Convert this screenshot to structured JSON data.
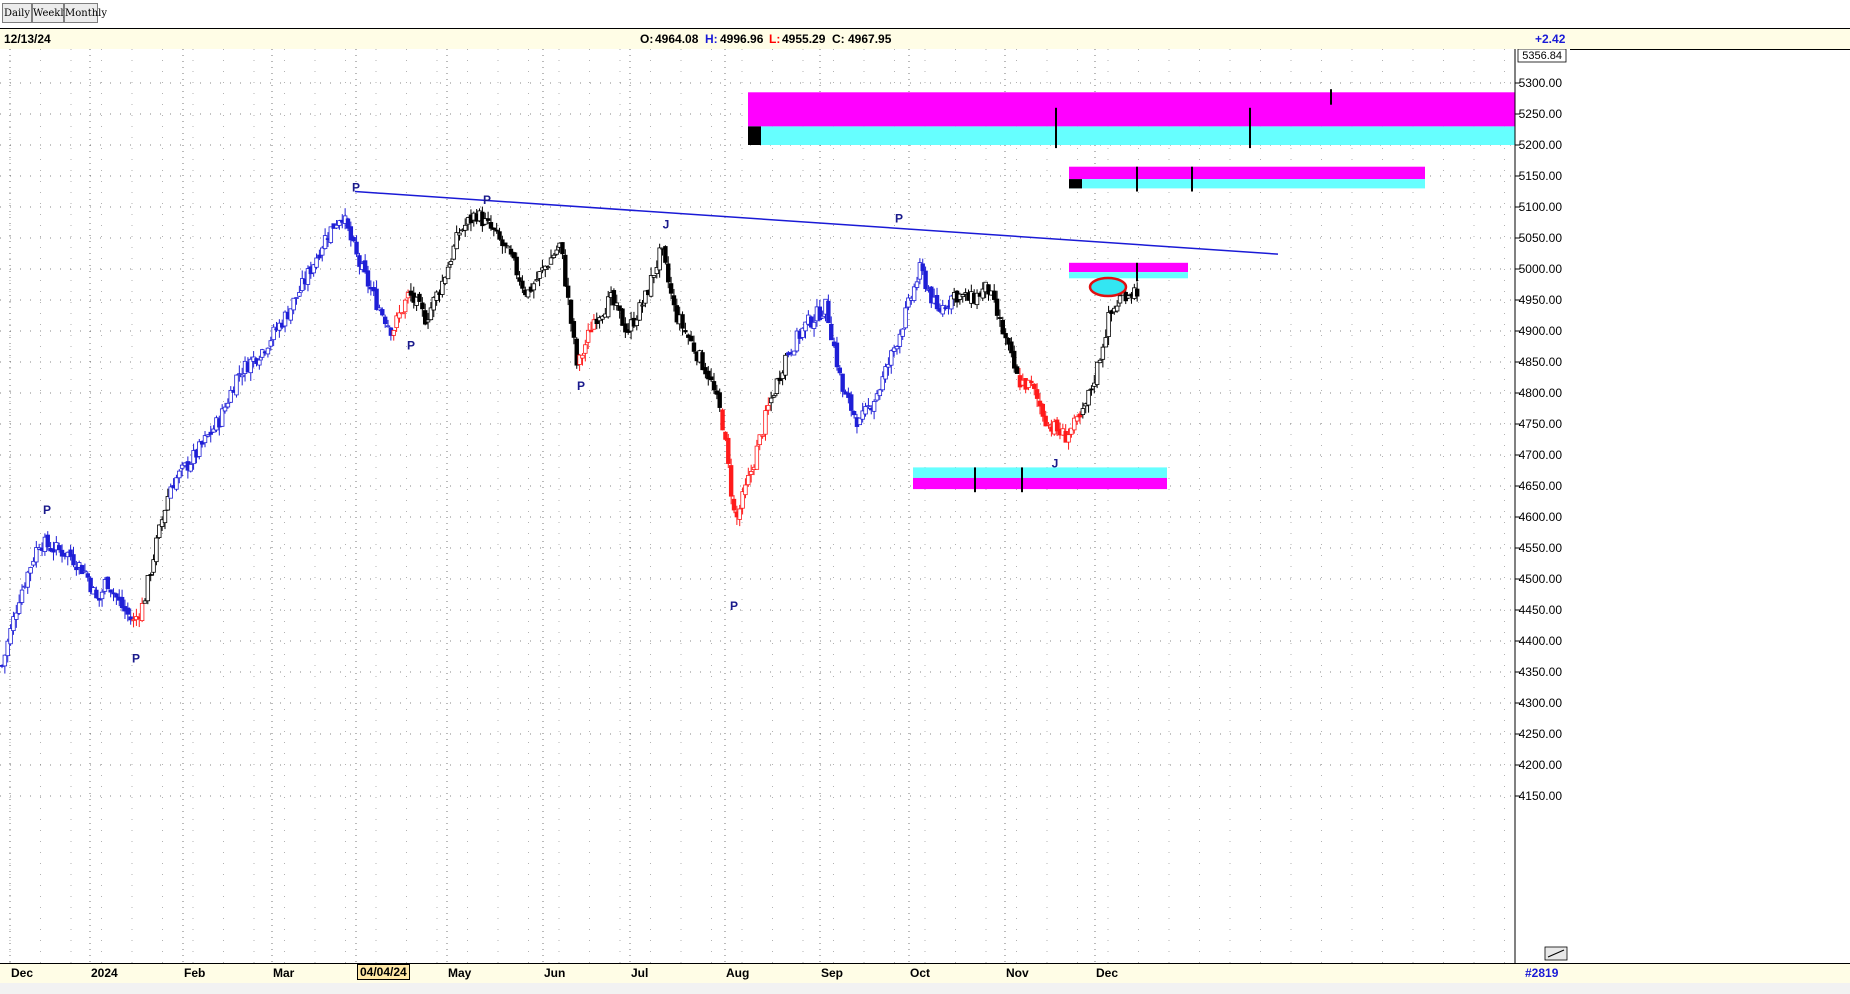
{
  "toolbar": {
    "daily": "Daily",
    "weekly": "Weekly",
    "monthly": "Monthly"
  },
  "info": {
    "date": "12/13/24",
    "open_label": "O:",
    "open": "4964.08",
    "high_label": "H:",
    "high": "4996.96",
    "low_label": "L:",
    "low": "4955.29",
    "close_label": "C:",
    "close": "4967.95",
    "change": "+2.42"
  },
  "right_axis": {
    "top_value": "5356.84",
    "count": "#2819"
  },
  "colors": {
    "up": "#1f1fd6",
    "down": "#ff1a1a",
    "neutral": "#000000",
    "magenta": "#ff00ff",
    "cyan": "#66ffff",
    "trend": "#1a1ad6"
  },
  "chart_data": {
    "type": "candlestick",
    "y_range": [
      4120,
      5370
    ],
    "y_ticks": [
      4150,
      4200,
      4250,
      4300,
      4350,
      4400,
      4450,
      4500,
      4550,
      4600,
      4650,
      4700,
      4750,
      4800,
      4850,
      4900,
      4950,
      5000,
      5050,
      5100,
      5150,
      5200,
      5250,
      5300
    ],
    "x_labels": [
      "Dec",
      "2024",
      "Feb",
      "Mar",
      "04/04/24",
      "May",
      "Jun",
      "Jul",
      "Aug",
      "Sep",
      "Oct",
      "Nov",
      "Dec"
    ],
    "selected_label": "04/04/24",
    "control_points": [
      {
        "d": 0,
        "c": 4360,
        "col": "u"
      },
      {
        "d": 10,
        "c": 4470,
        "col": "u"
      },
      {
        "d": 22,
        "c": 4560,
        "col": "u"
      },
      {
        "d": 30,
        "c": 4550,
        "col": "u"
      },
      {
        "d": 40,
        "c": 4540,
        "col": "u"
      },
      {
        "d": 50,
        "c": 4510,
        "col": "u"
      },
      {
        "d": 57,
        "c": 4460,
        "col": "u"
      },
      {
        "d": 62,
        "c": 4500,
        "col": "u"
      },
      {
        "d": 70,
        "c": 4460,
        "col": "u"
      },
      {
        "d": 78,
        "c": 4430,
        "col": "d"
      },
      {
        "d": 84,
        "c": 4460,
        "col": "n"
      },
      {
        "d": 92,
        "c": 4560,
        "col": "n"
      },
      {
        "d": 100,
        "c": 4650,
        "col": "u"
      },
      {
        "d": 115,
        "c": 4700,
        "col": "u"
      },
      {
        "d": 130,
        "c": 4760,
        "col": "u"
      },
      {
        "d": 140,
        "c": 4830,
        "col": "u"
      },
      {
        "d": 155,
        "c": 4870,
        "col": "u"
      },
      {
        "d": 170,
        "c": 4930,
        "col": "u"
      },
      {
        "d": 180,
        "c": 4980,
        "col": "u"
      },
      {
        "d": 192,
        "c": 5050,
        "col": "u"
      },
      {
        "d": 202,
        "c": 5090,
        "col": "u"
      },
      {
        "d": 212,
        "c": 5010,
        "col": "u"
      },
      {
        "d": 222,
        "c": 4950,
        "col": "u"
      },
      {
        "d": 232,
        "c": 4900,
        "col": "d"
      },
      {
        "d": 242,
        "c": 4960,
        "col": "n"
      },
      {
        "d": 252,
        "c": 4920,
        "col": "n"
      },
      {
        "d": 262,
        "c": 4980,
        "col": "n"
      },
      {
        "d": 272,
        "c": 5060,
        "col": "n"
      },
      {
        "d": 282,
        "c": 5090,
        "col": "n"
      },
      {
        "d": 292,
        "c": 5060,
        "col": "n"
      },
      {
        "d": 302,
        "c": 5020,
        "col": "n"
      },
      {
        "d": 312,
        "c": 4960,
        "col": "n"
      },
      {
        "d": 322,
        "c": 5000,
        "col": "n"
      },
      {
        "d": 332,
        "c": 5040,
        "col": "n"
      },
      {
        "d": 342,
        "c": 4840,
        "col": "d"
      },
      {
        "d": 352,
        "c": 4920,
        "col": "n"
      },
      {
        "d": 362,
        "c": 4950,
        "col": "n"
      },
      {
        "d": 372,
        "c": 4900,
        "col": "n"
      },
      {
        "d": 382,
        "c": 4950,
        "col": "n"
      },
      {
        "d": 392,
        "c": 5030,
        "col": "n"
      },
      {
        "d": 400,
        "c": 4930,
        "col": "n"
      },
      {
        "d": 410,
        "c": 4880,
        "col": "n"
      },
      {
        "d": 420,
        "c": 4830,
        "col": "n"
      },
      {
        "d": 428,
        "c": 4760,
        "col": "d"
      },
      {
        "d": 436,
        "c": 4590,
        "col": "d"
      },
      {
        "d": 446,
        "c": 4680,
        "col": "d"
      },
      {
        "d": 456,
        "c": 4780,
        "col": "n"
      },
      {
        "d": 466,
        "c": 4860,
        "col": "u"
      },
      {
        "d": 478,
        "c": 4910,
        "col": "u"
      },
      {
        "d": 490,
        "c": 4940,
        "col": "u"
      },
      {
        "d": 500,
        "c": 4800,
        "col": "u"
      },
      {
        "d": 510,
        "c": 4750,
        "col": "u"
      },
      {
        "d": 522,
        "c": 4810,
        "col": "u"
      },
      {
        "d": 534,
        "c": 4900,
        "col": "u"
      },
      {
        "d": 546,
        "c": 5000,
        "col": "u"
      },
      {
        "d": 556,
        "c": 4930,
        "col": "u"
      },
      {
        "d": 566,
        "c": 4960,
        "col": "n"
      },
      {
        "d": 576,
        "c": 4950,
        "col": "n"
      },
      {
        "d": 586,
        "c": 4970,
        "col": "n"
      },
      {
        "d": 596,
        "c": 4890,
        "col": "n"
      },
      {
        "d": 604,
        "c": 4820,
        "col": "d"
      },
      {
        "d": 612,
        "c": 4810,
        "col": "d"
      },
      {
        "d": 622,
        "c": 4750,
        "col": "d"
      },
      {
        "d": 632,
        "c": 4730,
        "col": "d"
      },
      {
        "d": 642,
        "c": 4760,
        "col": "n"
      },
      {
        "d": 650,
        "c": 4830,
        "col": "n"
      },
      {
        "d": 658,
        "c": 4920,
        "col": "n"
      },
      {
        "d": 666,
        "c": 4960,
        "col": "n"
      },
      {
        "d": 676,
        "c": 4968,
        "col": "n"
      }
    ],
    "trend_line": {
      "from": [
        355,
        5125
      ],
      "to": [
        1278,
        5024
      ]
    },
    "zones": [
      {
        "x1": 748,
        "x2": 1515,
        "top": 5285,
        "mid": 5230,
        "bottom": 5200
      },
      {
        "x1": 1069,
        "x2": 1425,
        "top": 5165,
        "mid": 5145,
        "bottom": 5130
      },
      {
        "x1": 1069,
        "x2": 1188,
        "top": 5010,
        "mid": 4995,
        "bottom": 4985
      },
      {
        "x1": 913,
        "x2": 1167,
        "top": 4680,
        "mid": 4663,
        "bottom": 4645,
        "inverted": true
      }
    ],
    "annotations": [
      {
        "x": 47,
        "v": 4605,
        "t": "P"
      },
      {
        "x": 136,
        "v": 4365,
        "t": "P"
      },
      {
        "x": 356,
        "v": 5125,
        "t": "P"
      },
      {
        "x": 411,
        "v": 4870,
        "t": "P"
      },
      {
        "x": 487,
        "v": 5105,
        "t": "P"
      },
      {
        "x": 581,
        "v": 4805,
        "t": "P"
      },
      {
        "x": 666,
        "v": 5065,
        "t": "J"
      },
      {
        "x": 734,
        "v": 4450,
        "t": "P"
      },
      {
        "x": 899,
        "v": 5075,
        "t": "P"
      },
      {
        "x": 1055,
        "v": 4680,
        "t": "J"
      }
    ]
  }
}
